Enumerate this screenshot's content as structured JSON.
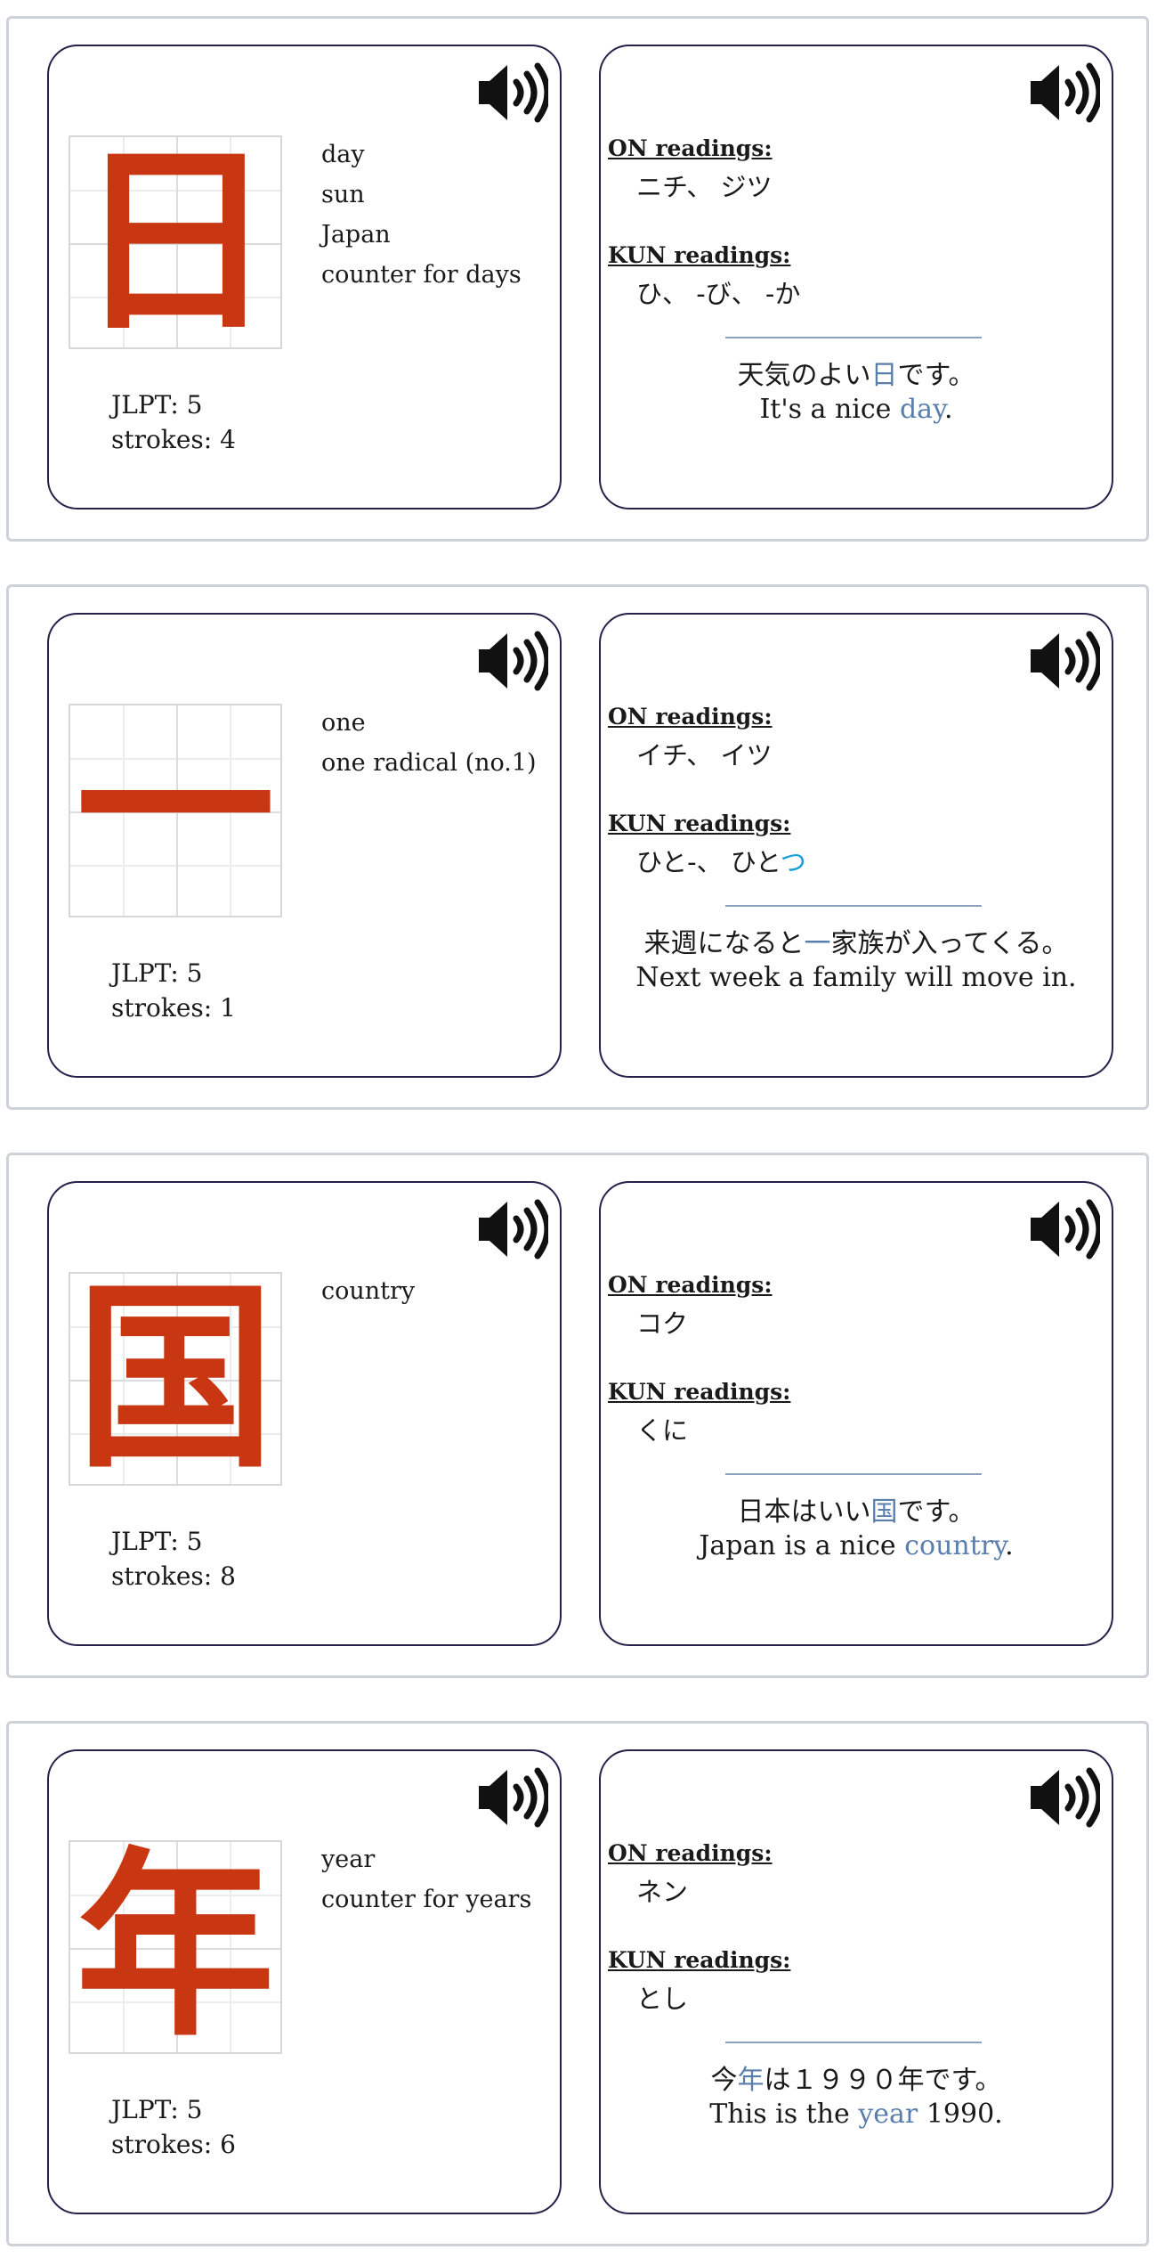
{
  "colors": {
    "kanji": "#c83612",
    "highlight": "#5a7fae",
    "kun_highlight": "#1a9fd6",
    "panel_border": "#22224a"
  },
  "labels": {
    "on": "ON readings:",
    "kun": "KUN readings:"
  },
  "cards": [
    {
      "kanji": "日",
      "meanings": [
        "day",
        "sun",
        "Japan",
        "counter for days"
      ],
      "jlpt": "JLPT: 5",
      "strokes": "strokes: 4",
      "on_readings": "ニチ、 ジツ",
      "kun_readings": {
        "before": "ひ、 -び、 -か",
        "highlight": ""
      },
      "example_jp": {
        "before": "天気のよい",
        "highlight": "日",
        "after": "です。"
      },
      "example_en": {
        "before": "It's a nice ",
        "highlight": "day",
        "after": "."
      },
      "speaker_icon": "speaker-icon"
    },
    {
      "kanji": "一",
      "meanings": [
        "one",
        "one radical (no.1)"
      ],
      "jlpt": "JLPT: 5",
      "strokes": "strokes: 1",
      "on_readings": "イチ、 イツ",
      "kun_readings": {
        "before": "ひと-、 ひと",
        "highlight": "つ"
      },
      "example_jp": {
        "before": "来週になると",
        "highlight": "一",
        "after": "家族が入ってくる。"
      },
      "example_en": {
        "before": "Next week a family will move in.",
        "highlight": "",
        "after": ""
      },
      "speaker_icon": "speaker-icon"
    },
    {
      "kanji": "国",
      "meanings": [
        "country"
      ],
      "jlpt": "JLPT: 5",
      "strokes": "strokes: 8",
      "on_readings": "コク",
      "kun_readings": {
        "before": "くに",
        "highlight": ""
      },
      "example_jp": {
        "before": "日本はいい",
        "highlight": "国",
        "after": "です。"
      },
      "example_en": {
        "before": "Japan is a nice ",
        "highlight": "country",
        "after": "."
      },
      "speaker_icon": "speaker-icon"
    },
    {
      "kanji": "年",
      "meanings": [
        "year",
        "counter for years"
      ],
      "jlpt": "JLPT: 5",
      "strokes": "strokes: 6",
      "on_readings": "ネン",
      "kun_readings": {
        "before": "とし",
        "highlight": ""
      },
      "example_jp": {
        "before": "今",
        "highlight": "年",
        "after": "は１９９０年です。"
      },
      "example_en": {
        "before": "This is the ",
        "highlight": "year",
        "after": " 1990."
      },
      "speaker_icon": "speaker-icon"
    }
  ]
}
